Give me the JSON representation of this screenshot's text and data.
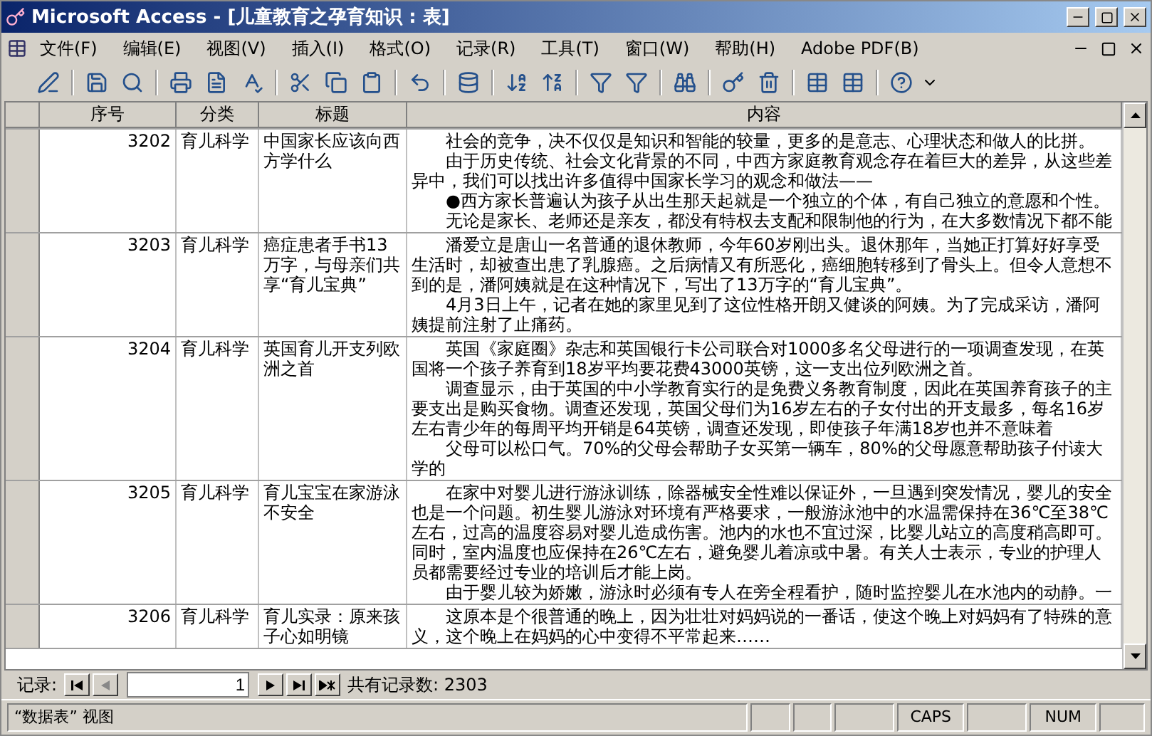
{
  "window": {
    "title": "Microsoft Access - [儿童教育之孕育知识 : 表]"
  },
  "menu": [
    "文件(F)",
    "编辑(E)",
    "视图(V)",
    "插入(I)",
    "格式(O)",
    "记录(R)",
    "工具(T)",
    "窗口(W)",
    "帮助(H)",
    "Adobe PDF(B)"
  ],
  "table": {
    "columns": [
      "序号",
      "分类",
      "标题",
      "内容"
    ],
    "rows": [
      {
        "id": "3202",
        "category": "育儿科学",
        "title": "中国家长应该向西方学什么",
        "content": [
          "社会的竞争，决不仅仅是知识和智能的较量，更多的是意志、心理状态和做人的比拼。",
          "由于历史传统、社会文化背景的不同，中西方家庭教育观念存在着巨大的差异，从这些差异中，我们可以找出许多值得中国家长学习的观念和做法——",
          "●西方家长普遍认为孩子从出生那天起就是一个独立的个体，有自己独立的意愿和个性。",
          "无论是家长、老师还是亲友，都没有特权去支配和限制他的行为，在大多数情况下都不能"
        ]
      },
      {
        "id": "3203",
        "category": "育儿科学",
        "title": "癌症患者手书13万字，与母亲们共享“育儿宝典”",
        "content": [
          "潘爱立是唐山一名普通的退休教师，今年60岁刚出头。退休那年，当她正打算好好享受生活时，却被查出患了乳腺癌。之后病情又有所恶化，癌细胞转移到了骨头上。但令人意想不到的是，潘阿姨就是在这种情况下，写出了13万字的“育儿宝典”。",
          "4月3日上午，记者在她的家里见到了这位性格开朗又健谈的阿姨。为了完成采访，潘阿姨提前注射了止痛药。"
        ]
      },
      {
        "id": "3204",
        "category": "育儿科学",
        "title": "英国育儿开支列欧洲之首",
        "content": [
          "英国《家庭圈》杂志和英国银行卡公司联合对1000多名父母进行的一项调查发现，在英国将一个孩子养育到18岁平均要花费43000英镑，这一支出位列欧洲之首。",
          "调查显示，由于英国的中小学教育实行的是免费义务教育制度，因此在英国养育孩子的主要支出是购买食物。调查还发现，英国父母们为16岁左右的子女付出的开支最多，每名16岁左右青少年的每周平均开销是64英镑，调查还发现，即使孩子年满18岁也并不意味着",
          "父母可以松口气。70%的父母会帮助子女买第一辆车，80%的父母愿意帮助孩子付读大学的"
        ]
      },
      {
        "id": "3205",
        "category": "育儿科学",
        "title": "育儿宝宝在家游泳不安全",
        "content": [
          "在家中对婴儿进行游泳训练，除器械安全性难以保证外，一旦遇到突发情况，婴儿的安全也是一个问题。初生婴儿游泳对环境有严格要求，一般游泳池中的水温需保持在36℃至38℃左右，过高的温度容易对婴儿造成伤害。池内的水也不宜过深，比婴儿站立的高度稍高即可。同时，室内温度也应保持在26℃左右，避免婴儿着凉或中暑。有关人士表示，专业的护理人员都需要经过专业的培训后才能上岗。",
          "由于婴儿较为娇嫩，游泳时必须有专人在旁全程看护，随时监控婴儿在水池内的动静。一"
        ]
      },
      {
        "id": "3206",
        "category": "育儿科学",
        "title": "育儿实录：原来孩子心如明镜",
        "content": [
          "这原本是个很普通的晚上，因为壮壮对妈妈说的一番话，使这个晚上对妈妈有了特殊的意义，这个晚上在妈妈的心中变得不平常起来……"
        ]
      }
    ]
  },
  "navigator": {
    "label": "记录:",
    "current": "1",
    "count": "共有记录数: 2303"
  },
  "status_bar": {
    "view": "“数据表” 视图",
    "caps": "CAPS",
    "num": "NUM"
  }
}
